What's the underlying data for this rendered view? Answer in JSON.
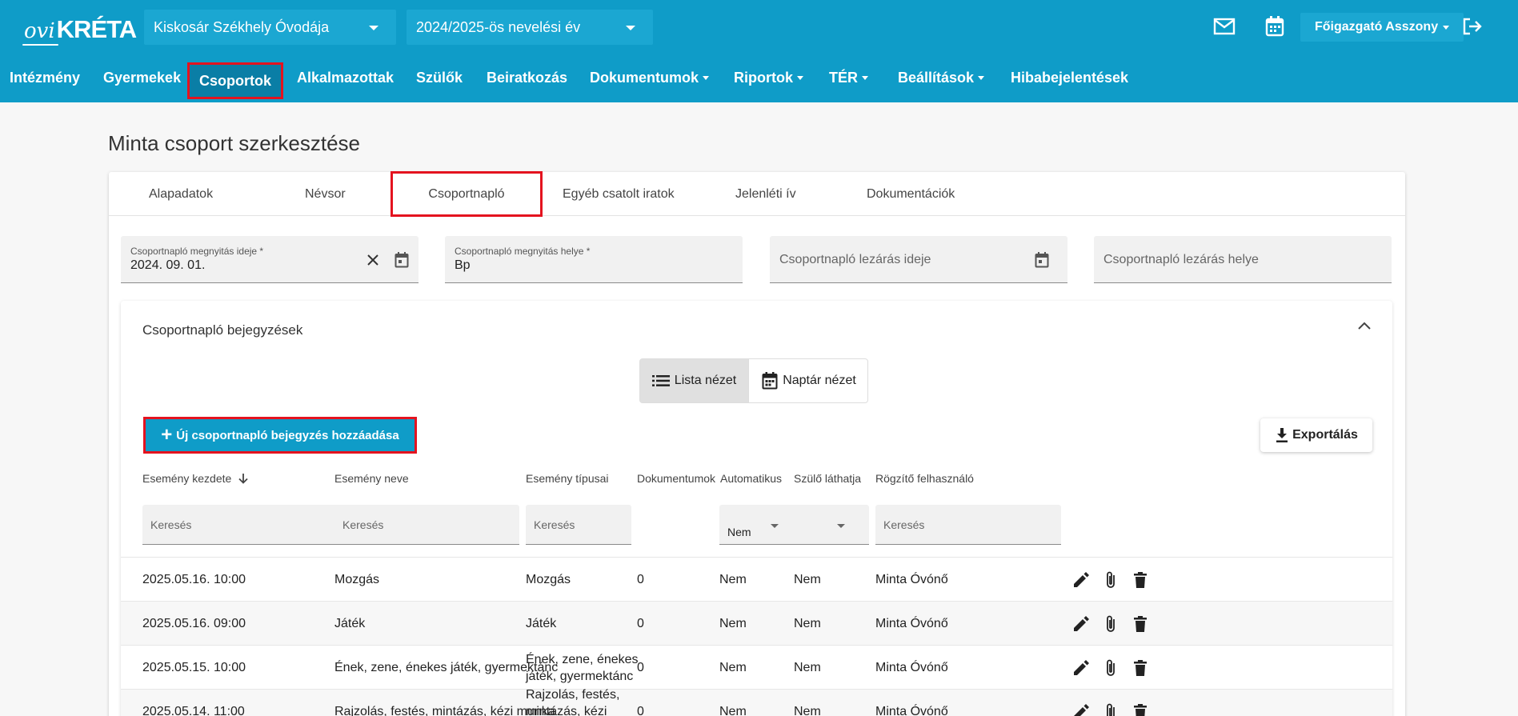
{
  "header": {
    "logo_ovi": "ovi",
    "logo_kreta": "KRÉTA",
    "institution": "Kiskosár Székhely Óvodája",
    "year": "2024/2025-ös nevelési év",
    "user": "Főigazgató Asszony"
  },
  "nav": {
    "items": [
      "Intézmény",
      "Gyermekek",
      "Csoportok",
      "Alkalmazottak",
      "Szülők",
      "Beiratkozás",
      "Dokumentumok",
      "Riportok",
      "TÉR",
      "Beállítások",
      "Hibabejelentések"
    ],
    "active": "Csoportok",
    "dropdown_items": [
      "Dokumentumok",
      "Riportok",
      "TÉR",
      "Beállítások"
    ]
  },
  "page_title": "Minta csoport szerkesztése",
  "tabs": [
    "Alapadatok",
    "Névsor",
    "Csoportnapló",
    "Egyéb csatolt iratok",
    "Jelenléti ív",
    "Dokumentációk"
  ],
  "active_tab": "Csoportnapló",
  "fields": {
    "open_date_label": "Csoportnapló megnyitás ideje *",
    "open_date_value": "2024. 09. 01.",
    "open_place_label": "Csoportnapló megnyitás helye *",
    "open_place_value": "Bp",
    "close_date_placeholder": "Csoportnapló lezárás ideje",
    "close_place_placeholder": "Csoportnapló lezárás helye"
  },
  "entries": {
    "title": "Csoportnapló bejegyzések",
    "list_view": "Lista nézet",
    "calendar_view": "Naptár nézet",
    "add_button": "Új csoportnapló bejegyzés hozzáadása",
    "export_button": "Exportálás",
    "columns": {
      "start": "Esemény kezdete",
      "name": "Esemény neve",
      "types": "Esemény típusai",
      "documents": "Dokumentumok",
      "automatic": "Automatikus",
      "parent_visible": "Szülő láthatja",
      "recorder": "Rögzítő felhasználó"
    },
    "filters": {
      "search_placeholder": "Keresés",
      "automatic_value": "Nem"
    },
    "rows": [
      {
        "start": "2025.05.16. 10:00",
        "name": "Mozgás",
        "types": "Mozgás",
        "documents": "0",
        "automatic": "Nem",
        "parent_visible": "Nem",
        "recorder": "Minta Óvónő"
      },
      {
        "start": "2025.05.16. 09:00",
        "name": "Játék",
        "types": "Játék",
        "documents": "0",
        "automatic": "Nem",
        "parent_visible": "Nem",
        "recorder": "Minta Óvónő"
      },
      {
        "start": "2025.05.15. 10:00",
        "name": "Ének, zene, énekes játék, gyermektánc",
        "types": "Ének, zene, énekes játék, gyermektánc",
        "documents": "0",
        "automatic": "Nem",
        "parent_visible": "Nem",
        "recorder": "Minta Óvónő"
      },
      {
        "start": "2025.05.14. 11:00",
        "name": "Rajzolás, festés, mintázás, kézi munka",
        "types": "Rajzolás, festés, mintázás, kézi munka",
        "documents": "0",
        "automatic": "Nem",
        "parent_visible": "Nem",
        "recorder": "Minta Óvónő"
      }
    ]
  },
  "colors": {
    "primary": "#0f9cc8",
    "highlight": "#e4131f"
  }
}
